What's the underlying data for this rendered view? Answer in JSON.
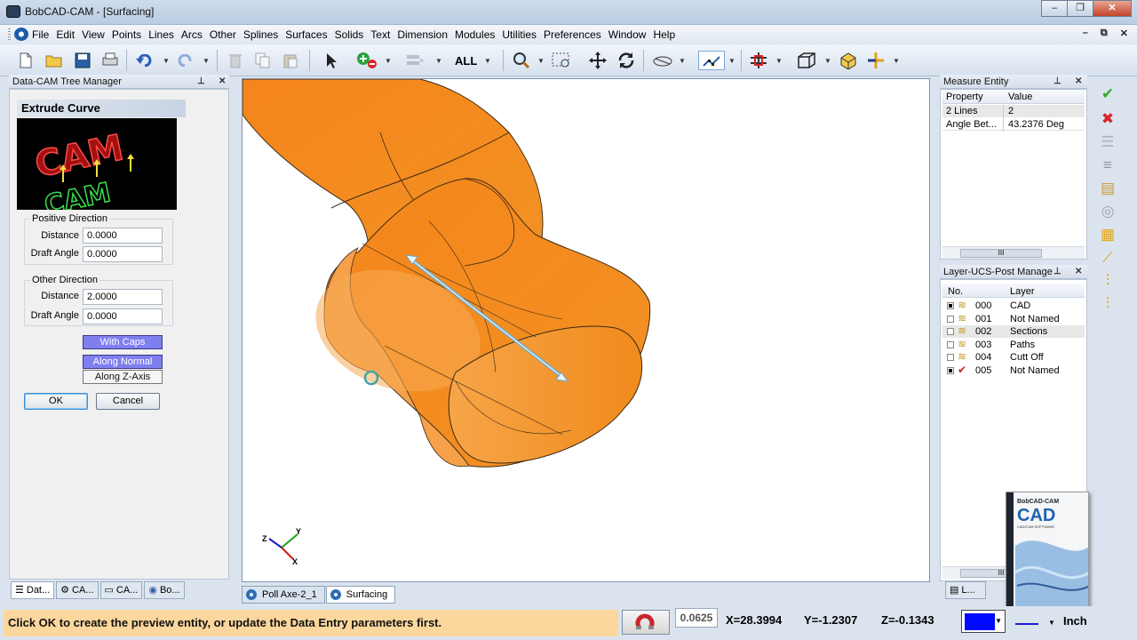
{
  "window": {
    "title": "BobCAD-CAM - [Surfacing]",
    "min": "–",
    "max": "❐",
    "close": "✕"
  },
  "menu": [
    "File",
    "Edit",
    "View",
    "Points",
    "Lines",
    "Arcs",
    "Other",
    "Splines",
    "Surfaces",
    "Solids",
    "Text",
    "Dimension",
    "Modules",
    "Utilities",
    "Preferences",
    "Window",
    "Help"
  ],
  "mdi": {
    "min": "–",
    "restore": "⧉",
    "close": "✕"
  },
  "toolbar": {
    "all_label": "ALL"
  },
  "tree": {
    "title": "Data-CAM Tree Manager",
    "section": "Extrude Curve",
    "logo_top": "CAM",
    "logo_bottom": "CAM",
    "positive": {
      "label": "Positive Direction",
      "distance_label": "Distance",
      "distance": "0.0000",
      "draft_label": "Draft Angle",
      "draft": "0.0000"
    },
    "other": {
      "label": "Other Direction",
      "distance_label": "Distance",
      "distance": "2.0000",
      "draft_label": "Draft Angle",
      "draft": "0.0000"
    },
    "with_caps": "With Caps",
    "along_normal": "Along Normal",
    "along_z": "Along Z-Axis",
    "ok": "OK",
    "cancel": "Cancel",
    "tabs": [
      "Dat...",
      "CA...",
      "CA...",
      "Bo..."
    ]
  },
  "view_tabs": [
    "Poll Axe-2_1",
    "Surfacing"
  ],
  "axes": {
    "z": "Z",
    "y": "Y",
    "x": "X"
  },
  "measure": {
    "title": "Measure Entity",
    "col_property": "Property",
    "col_value": "Value",
    "rows": [
      {
        "property": "2 Lines",
        "value": "2"
      },
      {
        "property": "Angle Bet...",
        "value": "43.2376 Deg"
      }
    ]
  },
  "layers": {
    "title": "Layer-UCS-Post Manage",
    "col_no": "No.",
    "col_layer": "Layer",
    "rows": [
      {
        "no": "000",
        "name": "CAD"
      },
      {
        "no": "001",
        "name": "Not Named"
      },
      {
        "no": "002",
        "name": "Sections"
      },
      {
        "no": "003",
        "name": "Paths"
      },
      {
        "no": "004",
        "name": "Cutt Off"
      },
      {
        "no": "005",
        "name": "Not Named"
      }
    ],
    "tab": "L..."
  },
  "product": {
    "brand": "BobCAD-CAM",
    "title": "CAD",
    "subtitle": "CAD/CAM SOFTWARE"
  },
  "status": {
    "message": "Click OK to create the preview entity, or update the Data Entry parameters first.",
    "snap": "0.0625",
    "x": "X=28.3994",
    "y": "Y=-1.2307",
    "z": "Z=-0.1343",
    "unit": "Inch"
  },
  "colors": {
    "object": "#f7941d",
    "status_bg": "#fbd79d",
    "current_color": "#0008ff"
  }
}
